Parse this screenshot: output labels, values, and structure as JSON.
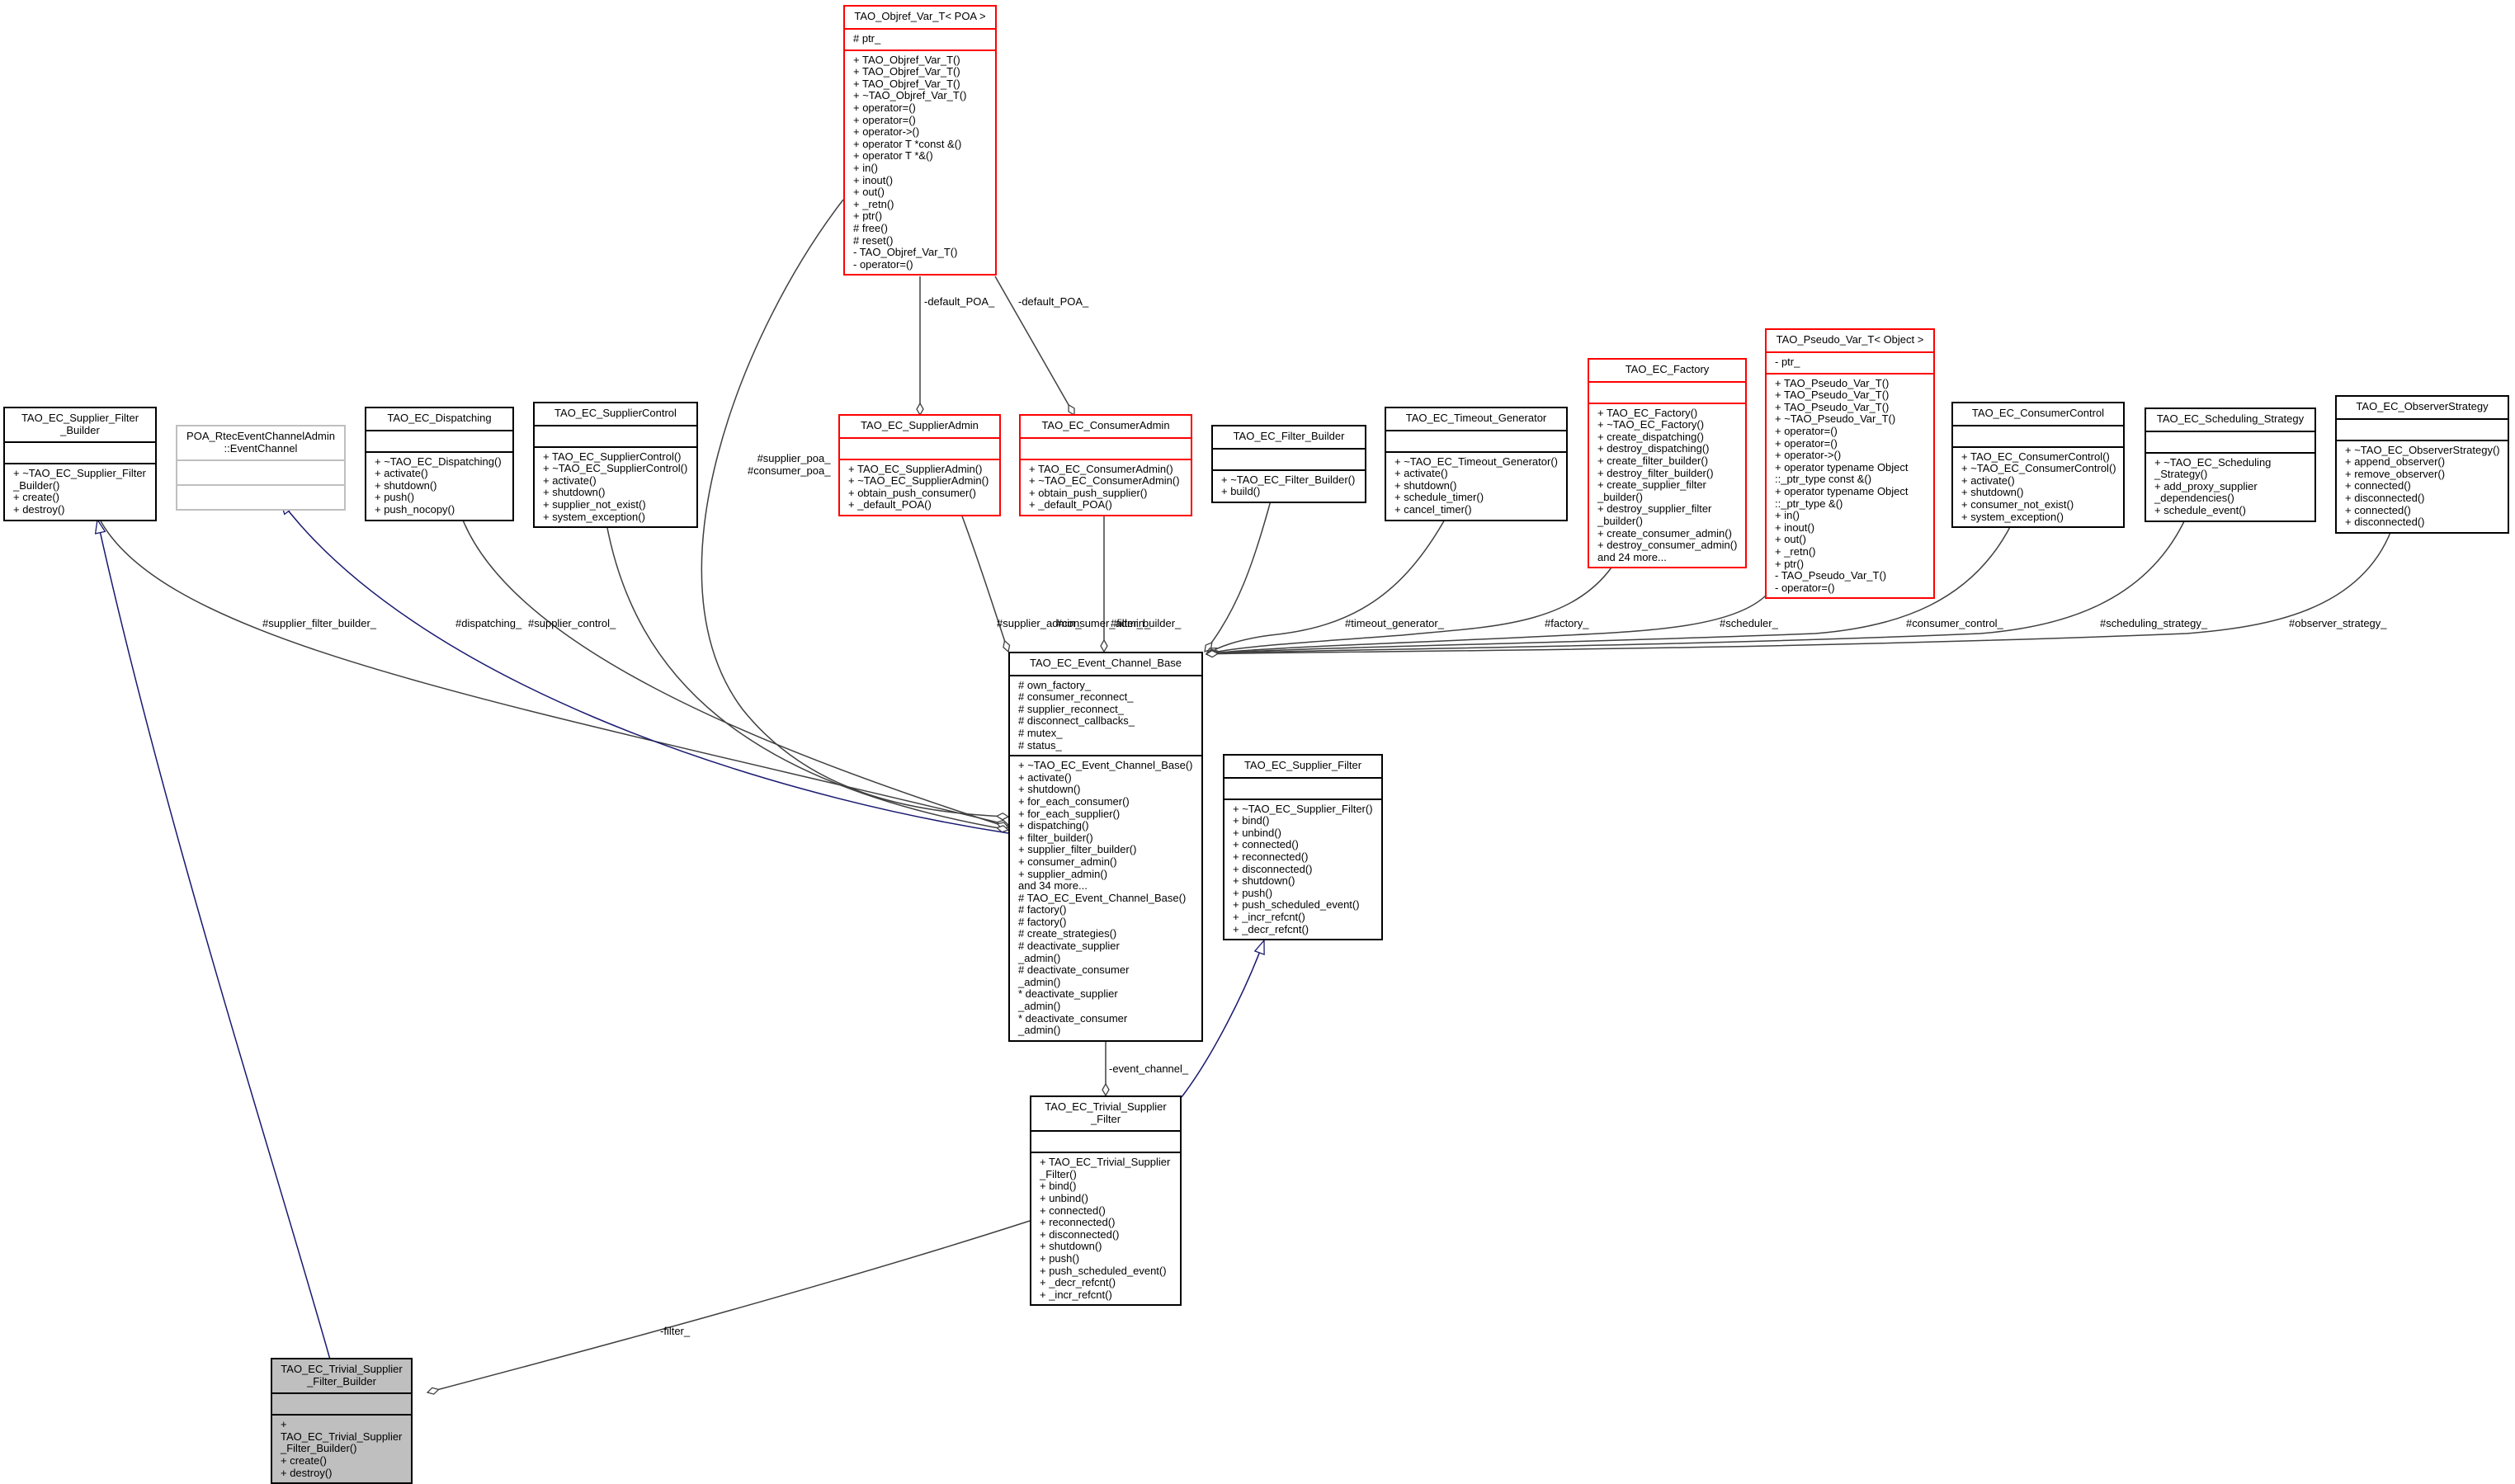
{
  "diagram": {
    "type": "UML collaboration diagram",
    "focus_class": "TAO_EC_Trivial_Supplier_Filter_Builder",
    "colors": {
      "normal_border": "#000000",
      "template_border": "#ff0000",
      "external_border": "#bfbfbf",
      "focus_fill": "#bfbfbf",
      "inheritance_edge": "#191970",
      "usage_edge": "#404040"
    }
  },
  "classes": {
    "objref_var": {
      "title": "TAO_Objref_Var_T< POA >",
      "attributes": [
        "# ptr_"
      ],
      "methods": [
        "+ TAO_Objref_Var_T()",
        "+ TAO_Objref_Var_T()",
        "+ TAO_Objref_Var_T()",
        "+ ~TAO_Objref_Var_T()",
        "+ operator=()",
        "+ operator=()",
        "+ operator->()",
        "+ operator T *const &()",
        "+ operator T *&()",
        "+ in()",
        "+ inout()",
        "+ out()",
        "+ _retn()",
        "+ ptr()",
        "# free()",
        "# reset()",
        "- TAO_Objref_Var_T()",
        "- operator=()"
      ]
    },
    "supplier_filter_builder": {
      "title": "TAO_EC_Supplier_Filter\n_Builder",
      "attributes": [],
      "methods": [
        "+ ~TAO_EC_Supplier_Filter\n_Builder()",
        "+ create()",
        "+ destroy()"
      ]
    },
    "poa_event_channel": {
      "title": "POA_RtecEventChannelAdmin\n::EventChannel",
      "attributes": [],
      "methods": []
    },
    "dispatching": {
      "title": "TAO_EC_Dispatching",
      "attributes": [],
      "methods": [
        "+ ~TAO_EC_Dispatching()",
        "+ activate()",
        "+ shutdown()",
        "+ push()",
        "+ push_nocopy()"
      ]
    },
    "supplier_control": {
      "title": "TAO_EC_SupplierControl",
      "attributes": [],
      "methods": [
        "+ TAO_EC_SupplierControl()",
        "+ ~TAO_EC_SupplierControl()",
        "+ activate()",
        "+ shutdown()",
        "+ supplier_not_exist()",
        "+ system_exception()"
      ]
    },
    "supplier_admin": {
      "title": "TAO_EC_SupplierAdmin",
      "attributes": [],
      "methods": [
        "+ TAO_EC_SupplierAdmin()",
        "+ ~TAO_EC_SupplierAdmin()",
        "+ obtain_push_consumer()",
        "+ _default_POA()"
      ]
    },
    "consumer_admin": {
      "title": "TAO_EC_ConsumerAdmin",
      "attributes": [],
      "methods": [
        "+ TAO_EC_ConsumerAdmin()",
        "+ ~TAO_EC_ConsumerAdmin()",
        "+ obtain_push_supplier()",
        "+ _default_POA()"
      ]
    },
    "filter_builder": {
      "title": "TAO_EC_Filter_Builder",
      "attributes": [],
      "methods": [
        "+ ~TAO_EC_Filter_Builder()",
        "+ build()"
      ]
    },
    "timeout_generator": {
      "title": "TAO_EC_Timeout_Generator",
      "attributes": [],
      "methods": [
        "+ ~TAO_EC_Timeout_Generator()",
        "+ activate()",
        "+ shutdown()",
        "+ schedule_timer()",
        "+ cancel_timer()"
      ]
    },
    "factory": {
      "title": "TAO_EC_Factory",
      "attributes": [],
      "methods": [
        "+ TAO_EC_Factory()",
        "+ ~TAO_EC_Factory()",
        "+ create_dispatching()",
        "+ destroy_dispatching()",
        "+ create_filter_builder()",
        "+ destroy_filter_builder()",
        "+ create_supplier_filter\n_builder()",
        "+ destroy_supplier_filter\n_builder()",
        "+ create_consumer_admin()",
        "+ destroy_consumer_admin()",
        "and 24 more..."
      ]
    },
    "pseudo_var": {
      "title": "TAO_Pseudo_Var_T< Object >",
      "attributes": [
        "- ptr_"
      ],
      "methods": [
        "+ TAO_Pseudo_Var_T()",
        "+ TAO_Pseudo_Var_T()",
        "+ TAO_Pseudo_Var_T()",
        "+ ~TAO_Pseudo_Var_T()",
        "+ operator=()",
        "+ operator=()",
        "+ operator->()",
        "+ operator typename Object\n::_ptr_type const &()",
        "+ operator typename Object\n::_ptr_type &()",
        "+ in()",
        "+ inout()",
        "+ out()",
        "+ _retn()",
        "+ ptr()",
        "- TAO_Pseudo_Var_T()",
        "- operator=()"
      ]
    },
    "consumer_control": {
      "title": "TAO_EC_ConsumerControl",
      "attributes": [],
      "methods": [
        "+ TAO_EC_ConsumerControl()",
        "+ ~TAO_EC_ConsumerControl()",
        "+ activate()",
        "+ shutdown()",
        "+ consumer_not_exist()",
        "+ system_exception()"
      ]
    },
    "scheduling_strategy": {
      "title": "TAO_EC_Scheduling_Strategy",
      "attributes": [],
      "methods": [
        "+ ~TAO_EC_Scheduling\n_Strategy()",
        "+ add_proxy_supplier\n_dependencies()",
        "+ schedule_event()"
      ]
    },
    "observer_strategy": {
      "title": "TAO_EC_ObserverStrategy",
      "attributes": [],
      "methods": [
        "+ ~TAO_EC_ObserverStrategy()",
        "+ append_observer()",
        "+ remove_observer()",
        "+ connected()",
        "+ disconnected()",
        "+ connected()",
        "+ disconnected()"
      ]
    },
    "event_channel_base": {
      "title": "TAO_EC_Event_Channel_Base",
      "attributes": [
        "# own_factory_",
        "# consumer_reconnect_",
        "# supplier_reconnect_",
        "# disconnect_callbacks_",
        "# mutex_",
        "# status_"
      ],
      "methods": [
        "+ ~TAO_EC_Event_Channel_Base()",
        "+ activate()",
        "+ shutdown()",
        "+ for_each_consumer()",
        "+ for_each_supplier()",
        "+ dispatching()",
        "+ filter_builder()",
        "+ supplier_filter_builder()",
        "+ consumer_admin()",
        "+ supplier_admin()",
        "and 34 more...",
        "# TAO_EC_Event_Channel_Base()",
        "# factory()",
        "# factory()",
        "# create_strategies()",
        "# deactivate_supplier\n_admin()",
        "# deactivate_consumer\n_admin()",
        "* deactivate_supplier\n_admin()",
        "* deactivate_consumer\n_admin()"
      ]
    },
    "supplier_filter": {
      "title": "TAO_EC_Supplier_Filter",
      "attributes": [],
      "methods": [
        "+ ~TAO_EC_Supplier_Filter()",
        "+ bind()",
        "+ unbind()",
        "+ connected()",
        "+ reconnected()",
        "+ disconnected()",
        "+ shutdown()",
        "+ push()",
        "+ push_scheduled_event()",
        "+ _incr_refcnt()",
        "+ _decr_refcnt()"
      ]
    },
    "trivial_supplier_filter": {
      "title": "TAO_EC_Trivial_Supplier\n_Filter",
      "attributes": [],
      "methods": [
        "+ TAO_EC_Trivial_Supplier\n_Filter()",
        "+ bind()",
        "+ unbind()",
        "+ connected()",
        "+ reconnected()",
        "+ disconnected()",
        "+ shutdown()",
        "+ push()",
        "+ push_scheduled_event()",
        "+ _decr_refcnt()",
        "+ _incr_refcnt()"
      ]
    },
    "trivial_supplier_filter_builder": {
      "title": "TAO_EC_Trivial_Supplier\n_Filter_Builder",
      "attributes": [],
      "methods": [
        "+ TAO_EC_Trivial_Supplier\n_Filter_Builder()",
        "+ create()",
        "+ destroy()"
      ]
    }
  },
  "edge_labels": {
    "default_poa_1": "-default_POA_",
    "default_poa_2": "-default_POA_",
    "supplier_consumer_poa": "#supplier_poa_\n#consumer_poa_",
    "supplier_filter_builder": "#supplier_filter_builder_",
    "dispatching": "#dispatching_",
    "supplier_control": "#supplier_control_",
    "supplier_admin": "#supplier_admin_",
    "consumer_admin": "#consumer_admin_",
    "filter_builder": "#filter_builder_",
    "timeout_generator": "#timeout_generator_",
    "factory": "#factory_",
    "scheduler": "#scheduler_",
    "consumer_control": "#consumer_control_",
    "scheduling_strategy": "#scheduling_strategy_",
    "observer_strategy": "#observer_strategy_",
    "event_channel": "-event_channel_",
    "filter": "-filter_"
  }
}
